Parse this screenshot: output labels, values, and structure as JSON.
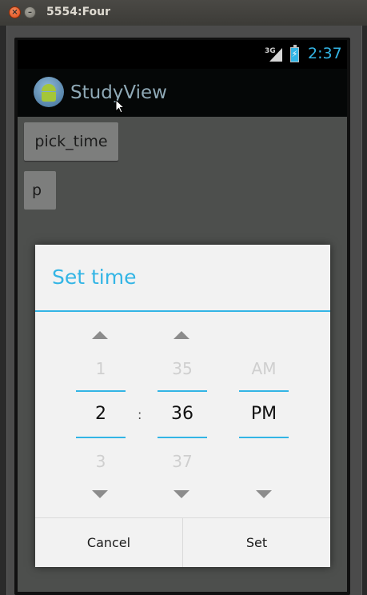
{
  "window": {
    "title": "5554:Four",
    "close_glyph": "×",
    "minimize_glyph": "–"
  },
  "statusbar": {
    "network": "3G",
    "time": "2:37",
    "battery_glyph": "⚡"
  },
  "actionbar": {
    "app_title": "StudyView"
  },
  "content": {
    "pick_time_label": "pick_time",
    "second_button_label": "p"
  },
  "dialog": {
    "title": "Set time",
    "hour": {
      "prev": "1",
      "current": "2",
      "next": "3"
    },
    "separator": ":",
    "minute": {
      "prev": "35",
      "current": "36",
      "next": "37"
    },
    "ampm": {
      "prev": "AM",
      "current": "PM"
    },
    "cancel_label": "Cancel",
    "set_label": "Set"
  },
  "colors": {
    "accent": "#33b5e5",
    "dialog_bg": "#f2f2f2",
    "actionbar_bg": "#050707"
  }
}
